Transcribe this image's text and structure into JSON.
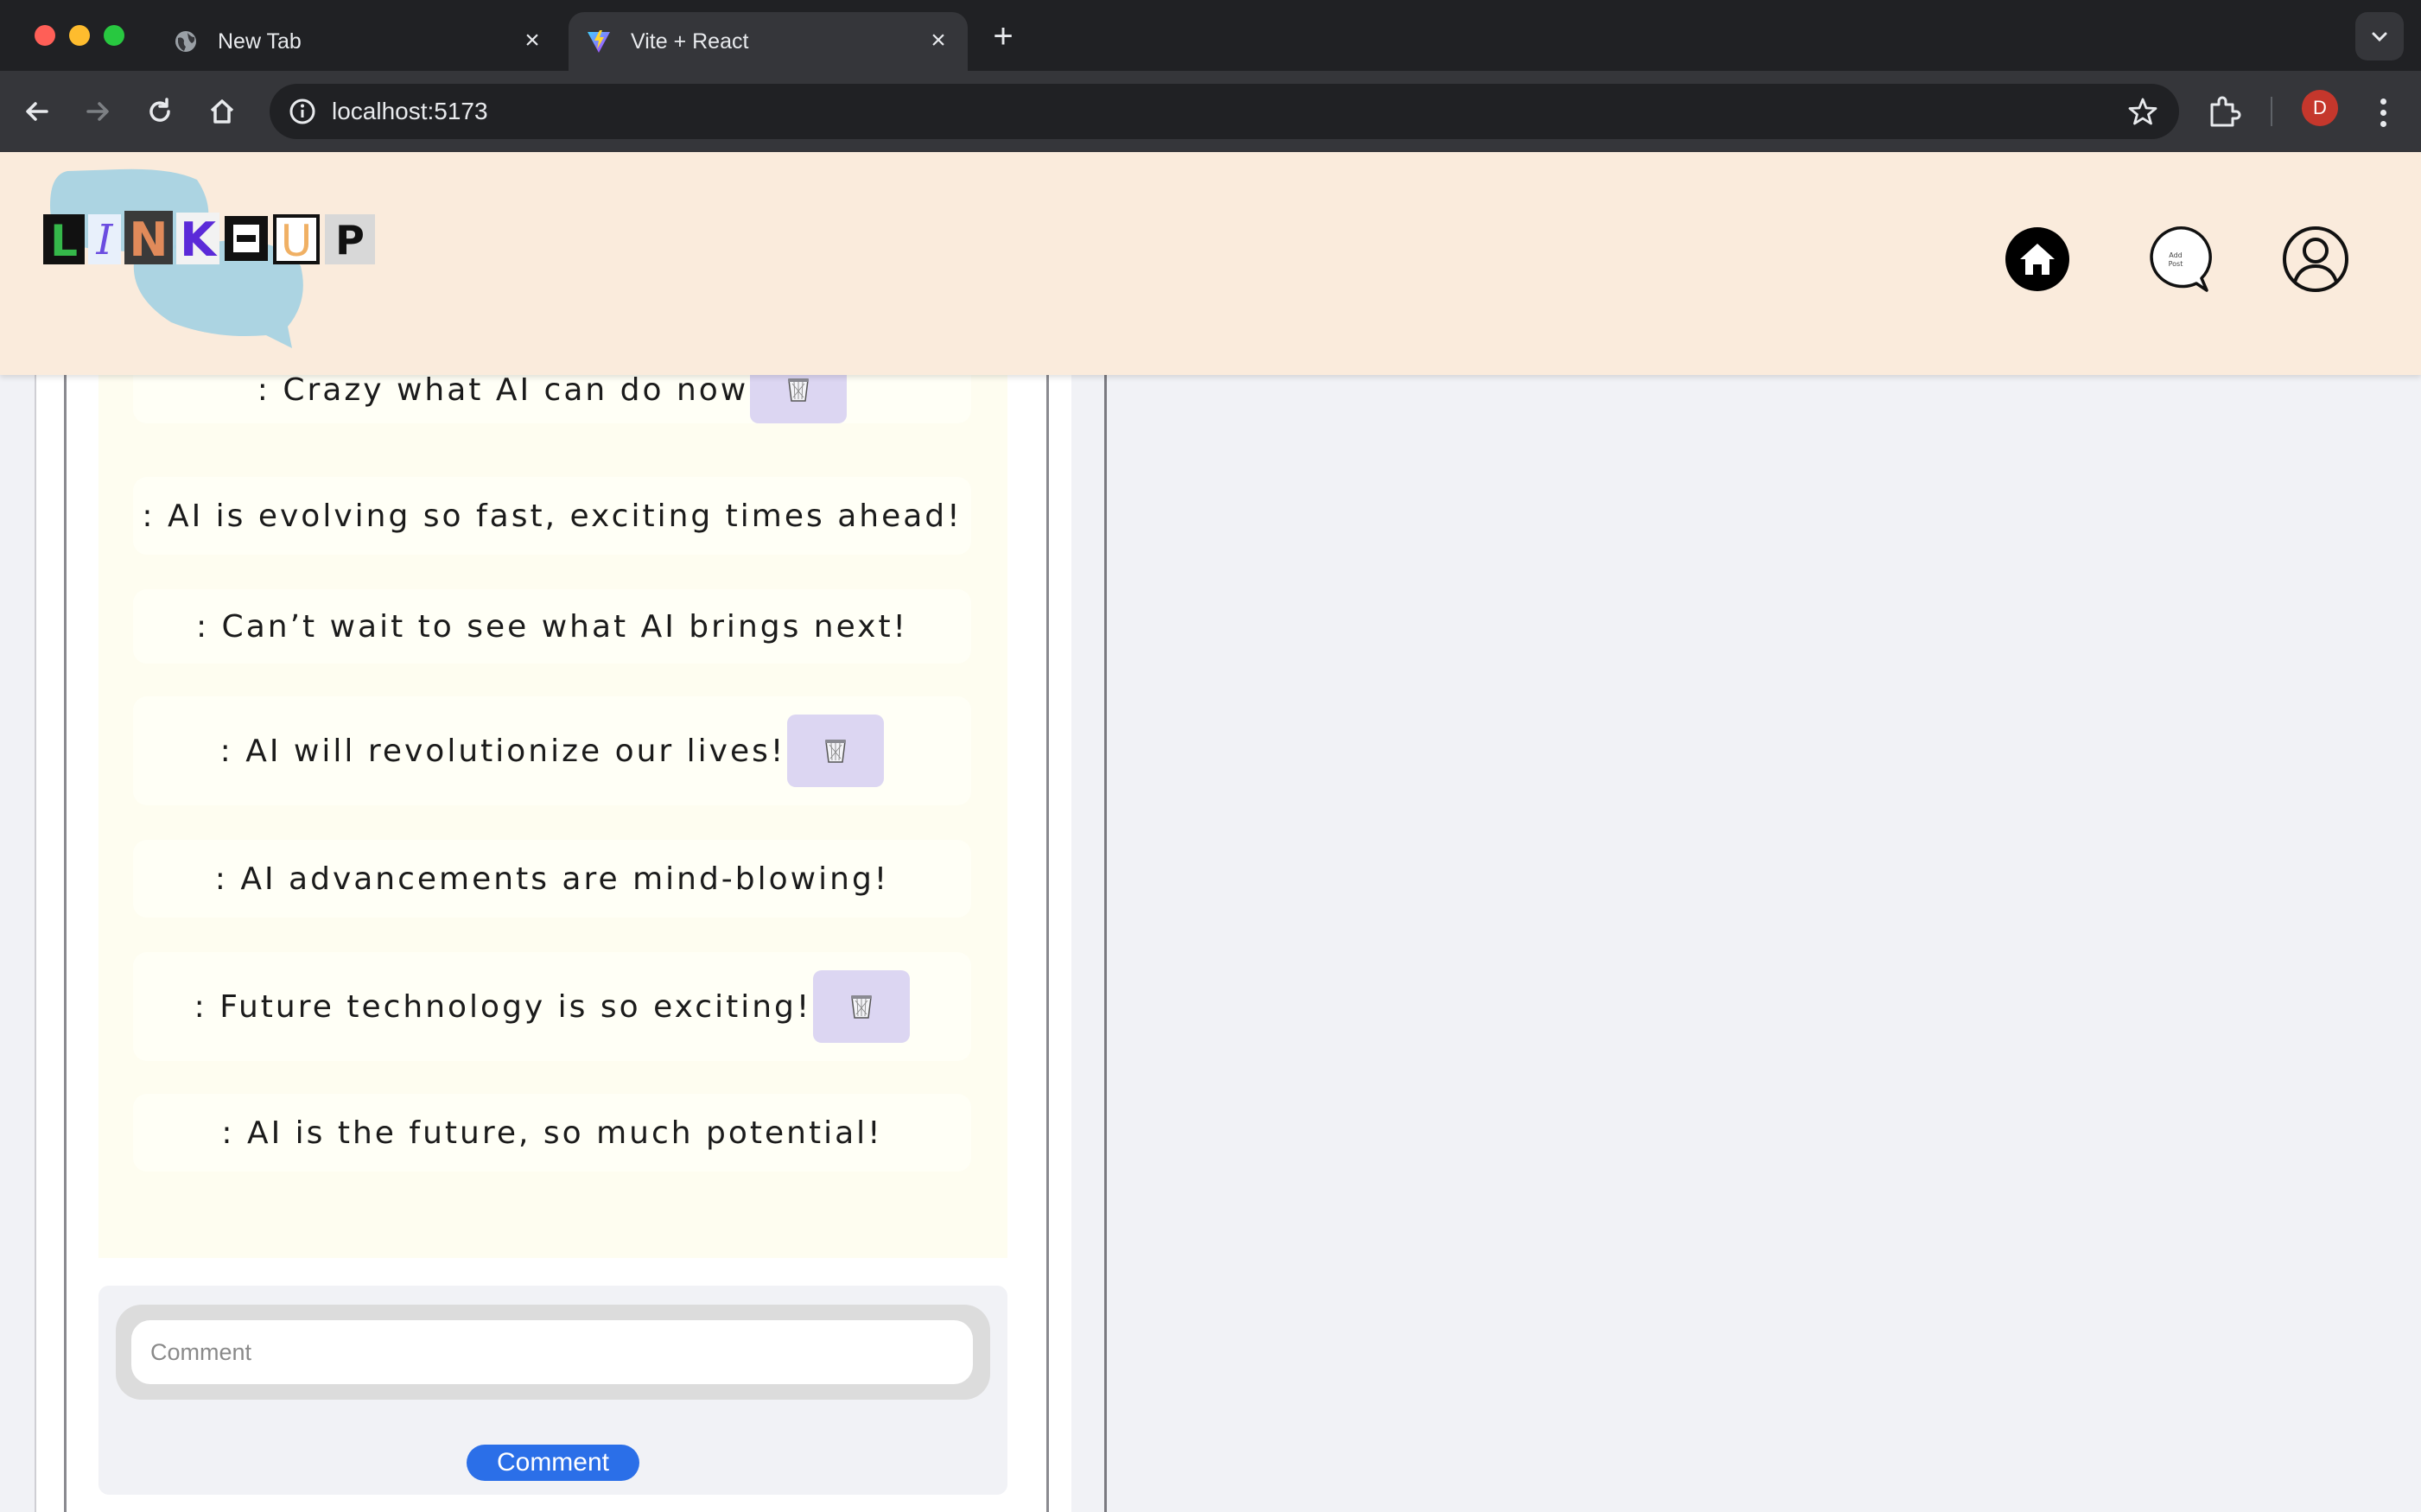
{
  "browser": {
    "tabs": [
      {
        "title": "New Tab",
        "active": false
      },
      {
        "title": "Vite + React",
        "active": true
      }
    ],
    "url": "localhost:5173",
    "profile_initial": "D"
  },
  "header": {
    "logo_letters": [
      "L",
      "I",
      "N",
      "K",
      "-",
      "U",
      "P"
    ],
    "nav": {
      "home_icon": "home-icon",
      "add_post_label": "Add Post",
      "profile_icon": "user-icon"
    }
  },
  "comments": [
    {
      "text": ": Crazy what AI can do now",
      "deletable": true
    },
    {
      "text": ": AI is evolving so fast, exciting times ahead!",
      "deletable": false
    },
    {
      "text": ": Can’t wait to see what AI brings next!",
      "deletable": false
    },
    {
      "text": ": AI will revolutionize our lives!",
      "deletable": true
    },
    {
      "text": ": AI advancements are mind-blowing!",
      "deletable": false
    },
    {
      "text": ": Future technology is so exciting!",
      "deletable": true
    },
    {
      "text": ": AI is the future, so much potential!",
      "deletable": false
    }
  ],
  "comment_form": {
    "placeholder": "Comment",
    "value": "",
    "submit_label": "Comment"
  },
  "colors": {
    "header_bg": "#faebdc",
    "comments_bg": "#fefdf0",
    "trash_bg": "#dcd6f2",
    "button_blue": "#2b6fe8"
  }
}
